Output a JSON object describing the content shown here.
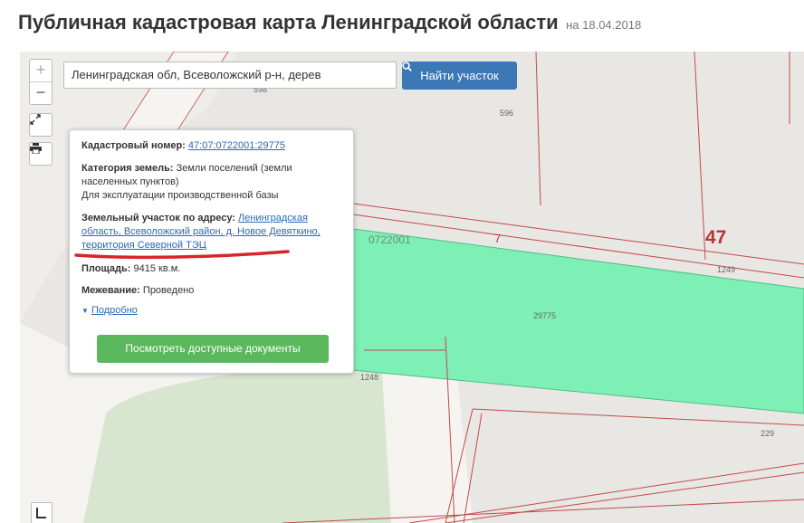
{
  "header": {
    "title": "Публичная кадастровая карта Ленинградской области",
    "date_label": "на 18.04.2018"
  },
  "search": {
    "value": "Ленинградская обл, Всеволожский р-н, дерев",
    "button_label": "Найти участок",
    "button_icon": "search-icon"
  },
  "controls": {
    "zoom_in": "+",
    "zoom_out": "−",
    "fullscreen_icon": "expand-icon",
    "print_icon": "printer-icon",
    "bottom_icon": "layers-icon"
  },
  "popup": {
    "cadastral_label": "Кадастровый номер:",
    "cadastral_value": "47:07:0722001:29775",
    "category_label": "Категория земель:",
    "category_value": "Земли поселений (земли населенных пунктов)",
    "usage": "Для эксплуатации производственной базы",
    "address_label": "Земельный участок по адресу:",
    "address_value": "Ленинградская область, Всеволожский район, д. Новое Девяткино, территория Северной ТЭЦ",
    "area_label": "Площадь:",
    "area_value": "9415 кв.м.",
    "survey_label": "Межевание:",
    "survey_value": "Проведено",
    "more_label": "Подробно",
    "docs_button": "Посмотреть доступные документы"
  },
  "map_labels": {
    "l596": "596",
    "l598": "598",
    "quarter": "0722001",
    "district": "7",
    "region": "47",
    "l1249": "1249",
    "l29775": "29775",
    "l1248": "1248",
    "l229": "229"
  },
  "colors": {
    "parcel_fill": "#7ef0b5",
    "boundary": "#c24a4a",
    "button_blue": "#3b78b5",
    "button_green": "#5cb85c",
    "annotation_red": "#d8242b"
  }
}
